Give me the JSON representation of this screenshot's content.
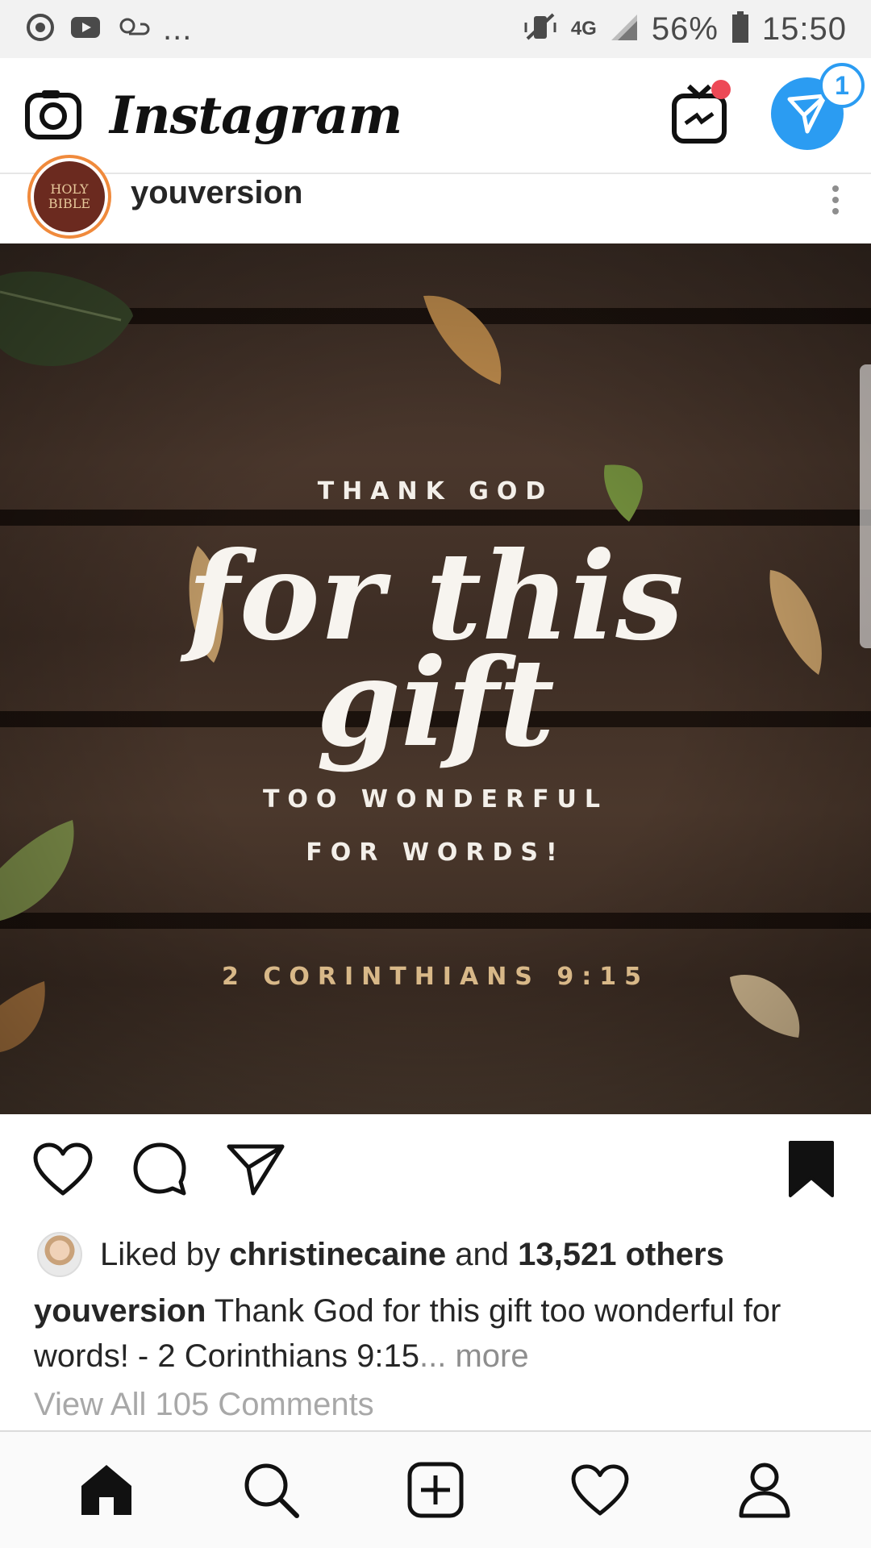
{
  "status_bar": {
    "ellipsis": "...",
    "network": "4G",
    "battery": "56%",
    "time": "15:50"
  },
  "app_bar": {
    "title": "Instagram",
    "dm_badge": "1"
  },
  "post": {
    "username": "youversion",
    "avatar_text": [
      "HOLY",
      "BIBLE"
    ],
    "image": {
      "line1": "THANK GOD",
      "script1": "for this",
      "script2": "gift",
      "line2": "TOO WONDERFUL",
      "line3": "FOR WORDS!",
      "reference": "2 CORINTHIANS 9:15"
    },
    "likes": {
      "prefix": "Liked by",
      "user": "christinecaine",
      "middle": "and",
      "count": "13,521 others"
    },
    "caption": {
      "user": "youversion",
      "text": "Thank God for this gift too wonderful for words! - 2 Corinthians 9:15",
      "more": "... more"
    },
    "comments_link": "View All 105 Comments"
  },
  "colors": {
    "accent_blue": "#2b9cf2",
    "notification_red": "#ed4956",
    "story_ring": "#f08a3c"
  },
  "icons": {
    "camera": "camera-icon",
    "igtv": "igtv-icon",
    "direct": "direct-message-icon",
    "like": "heart-icon",
    "comment": "comment-icon",
    "share": "send-icon",
    "save": "bookmark-icon",
    "home": "home-icon",
    "search": "search-icon",
    "new_post": "add-post-icon",
    "activity": "heart-icon",
    "profile": "profile-icon"
  }
}
